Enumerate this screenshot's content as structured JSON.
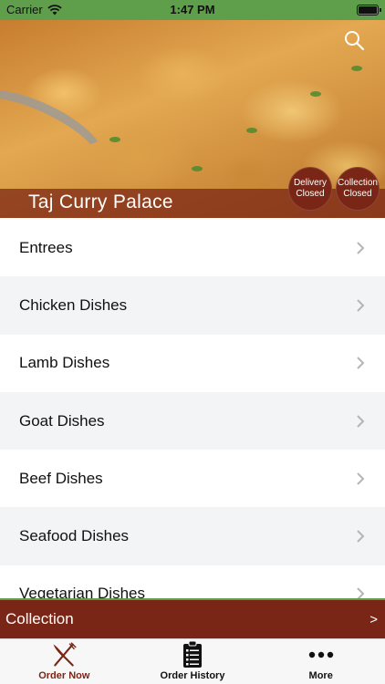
{
  "status_bar": {
    "carrier": "Carrier",
    "time": "1:47 PM"
  },
  "hero": {
    "restaurant_name": "Taj Curry Palace",
    "delivery_badge": {
      "line1": "Delivery",
      "line2": "Closed"
    },
    "collection_badge": {
      "line1": "Collection",
      "line2": "Closed"
    }
  },
  "categories": [
    {
      "label": "Entrees"
    },
    {
      "label": "Chicken Dishes"
    },
    {
      "label": "Lamb Dishes"
    },
    {
      "label": "Goat Dishes"
    },
    {
      "label": "Beef Dishes"
    },
    {
      "label": "Seafood Dishes"
    },
    {
      "label": "Vegetarian Dishes"
    }
  ],
  "collection_bar": {
    "label": "Collection",
    "arrow": ">"
  },
  "tab_bar": {
    "tabs": [
      {
        "label": "Order Now",
        "icon": "fork-knife-icon",
        "active": true
      },
      {
        "label": "Order History",
        "icon": "clipboard-list-icon",
        "active": false
      },
      {
        "label": "More",
        "icon": "more-dots-icon",
        "active": false
      }
    ]
  },
  "colors": {
    "brand": "#7a2616",
    "status_bar": "#5f9e4b",
    "row_alt": "#f3f4f6"
  }
}
